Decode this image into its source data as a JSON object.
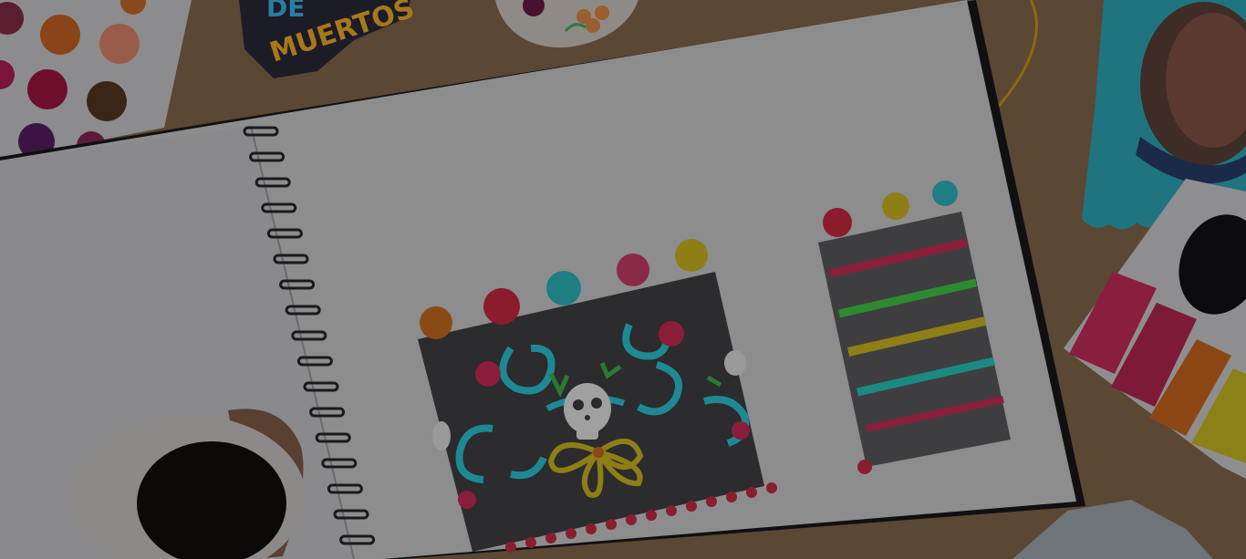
{
  "scene": {
    "sticker_text": [
      "DE",
      "MUERTOS"
    ],
    "palette": {
      "table": "#5a4a3c",
      "paper": "#8a8a8b",
      "cake_dark": "#2e2e30",
      "teal": "#2aa7b4",
      "pink": "#c8264a",
      "yellow": "#c8b01e",
      "orange": "#c8621e",
      "green": "#3aa84a"
    },
    "icons": [
      "watercolor-palette-icon",
      "coffee-cup-icon",
      "skull-icon",
      "rose-icon"
    ]
  }
}
